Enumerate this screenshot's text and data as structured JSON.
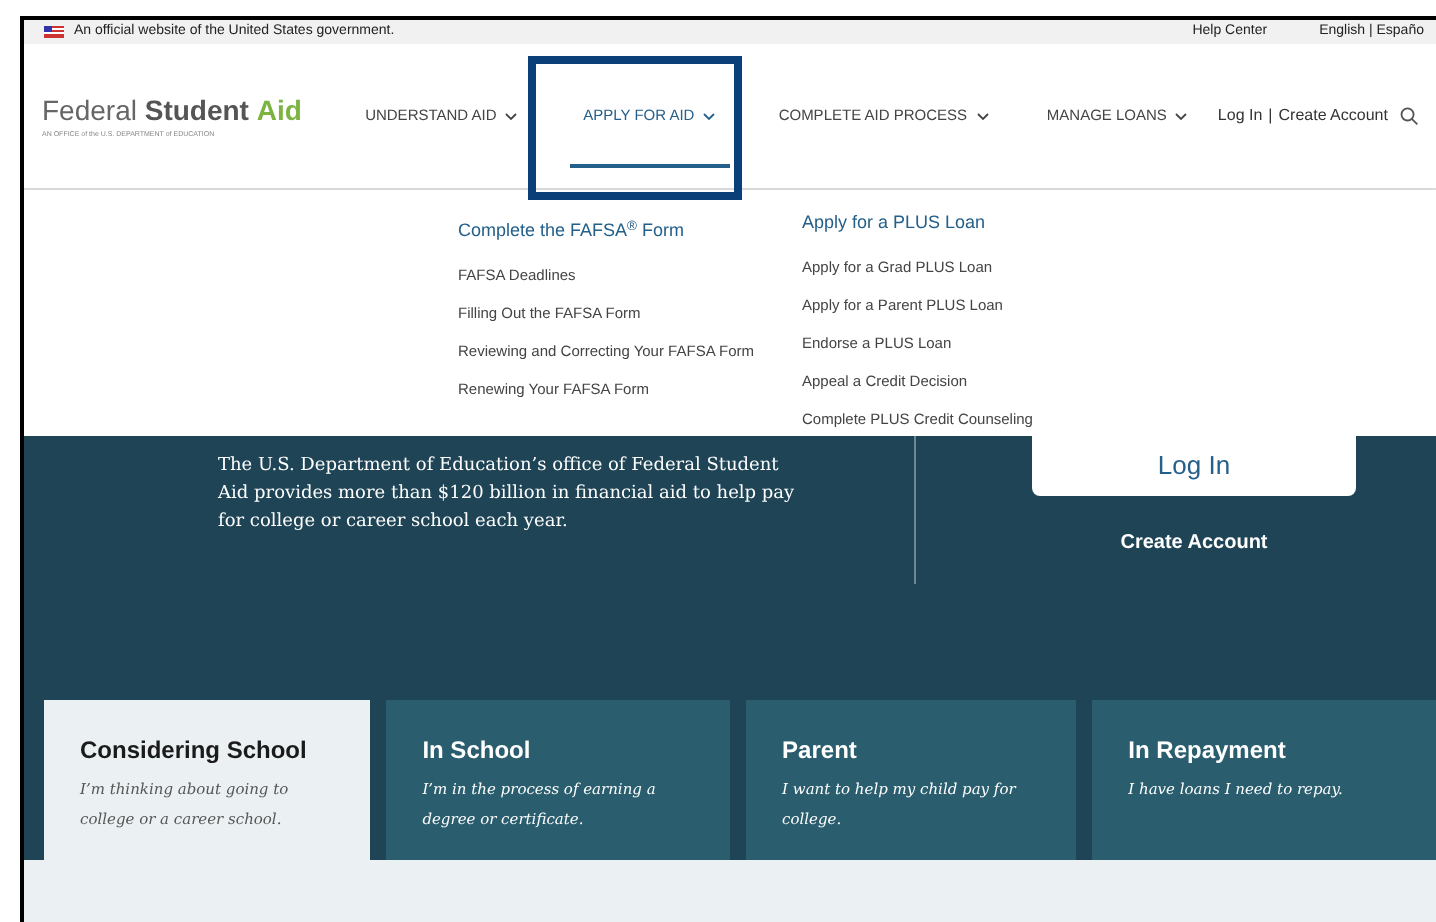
{
  "gov_banner": {
    "text": "An official website of the United States government.",
    "links": [
      "Help Center",
      "English | Españo"
    ]
  },
  "logo": {
    "plain": "Federal",
    "bold_1": "Student",
    "bold_2": "Aid",
    "tagline": "AN OFFICE of the U.S. DEPARTMENT of EDUCATION"
  },
  "nav": [
    {
      "label": "UNDERSTAND AID",
      "selected": false
    },
    {
      "label": "APPLY FOR AID",
      "selected": true
    },
    {
      "label": "COMPLETE AID PROCESS",
      "selected": false
    },
    {
      "label": "MANAGE LOANS",
      "selected": false
    }
  ],
  "account_links": [
    "Log In",
    "Create Account"
  ],
  "account_separator": "|",
  "dropdown": {
    "columns": [
      {
        "heading": "Complete the FAFSA$^{®}$ Form",
        "items": [
          "FAFSA Deadlines",
          "Filling Out the FAFSA Form",
          "Reviewing and Correcting Your FAFSA Form",
          "Renewing Your FAFSA Form"
        ]
      },
      {
        "heading": "Apply for a PLUS Loan",
        "items": [
          "Apply for a Grad PLUS Loan",
          "Apply for a Parent PLUS Loan",
          "Endorse a PLUS Loan",
          "Appeal a Credit Decision",
          "Complete PLUS Credit Counseling"
        ]
      }
    ]
  },
  "hero": {
    "text": "The U.S. Department of Education’s office of Federal Student Aid provides more than $120 billion in financial aid to help pay for college or career school each year.",
    "login_button": "Log In",
    "create_account": "Create Account"
  },
  "cards": [
    {
      "title": "Considering School",
      "text": "I’m thinking about going to college or a career school.",
      "selected": true
    },
    {
      "title": "In School",
      "text": "I’m in the process of earning a degree or certificate.",
      "selected": false
    },
    {
      "title": "Parent",
      "text": "I want to help my child pay for college.",
      "selected": false
    },
    {
      "title": "In Repayment",
      "text": "I have loans I need to repay.",
      "selected": false
    }
  ]
}
